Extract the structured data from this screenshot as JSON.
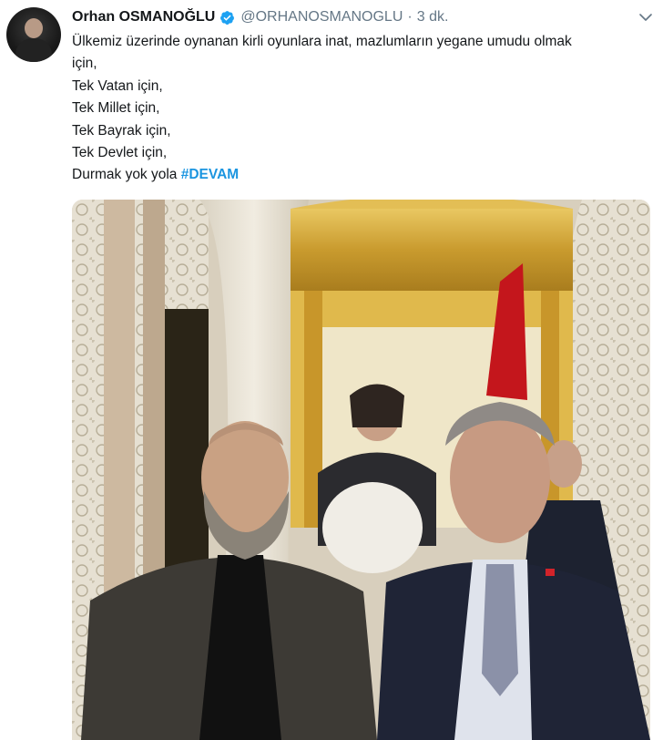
{
  "tweet": {
    "author_name": "Orhan OSMANOĞLU",
    "author_handle": "@ORHANOSMANOGLU",
    "separator": "·",
    "time": "3 dk.",
    "lines": [
      "Ülkemiz üzerinde oynanan kirli oyunlara inat, mazlumların yegane umudu olmak",
      "için,",
      "Tek Vatan için,",
      "Tek Millet için,",
      "Tek Bayrak için,",
      "Tek Devlet için,"
    ],
    "last_line_prefix": "Durmak yok yola ",
    "hashtag": "#DEVAM"
  },
  "colors": {
    "text": "#14171a",
    "secondary": "#657786",
    "link": "#1b95e0",
    "verified": "#1da1f2"
  },
  "icons": {
    "verified": "verified-badge-icon",
    "menu": "chevron-down-icon"
  }
}
